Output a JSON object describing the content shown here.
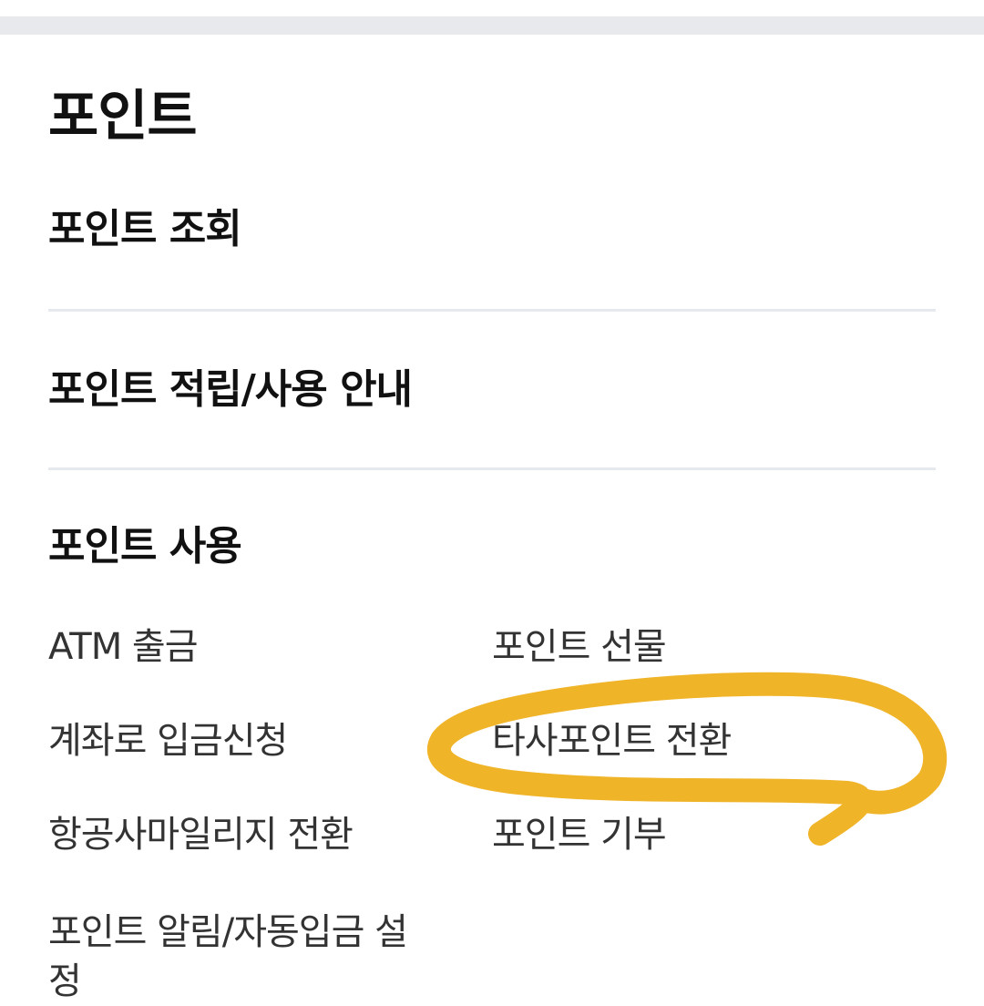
{
  "page": {
    "section_title": "포인트"
  },
  "menu": {
    "lookup_label": "포인트 조회",
    "guide_label": "포인트 적립/사용 안내"
  },
  "use_section": {
    "title": "포인트 사용",
    "links": {
      "atm": "ATM 출금",
      "gift": "포인트 선물",
      "account_deposit": "계좌로 입금신청",
      "other_conversion": "타사포인트 전환",
      "airline_conversion": "항공사마일리지 전환",
      "donation": "포인트 기부",
      "alert_auto_deposit": "포인트 알림/자동입금 설정"
    }
  },
  "annotation": {
    "color": "#f0b429",
    "target": "타사포인트 전환"
  }
}
